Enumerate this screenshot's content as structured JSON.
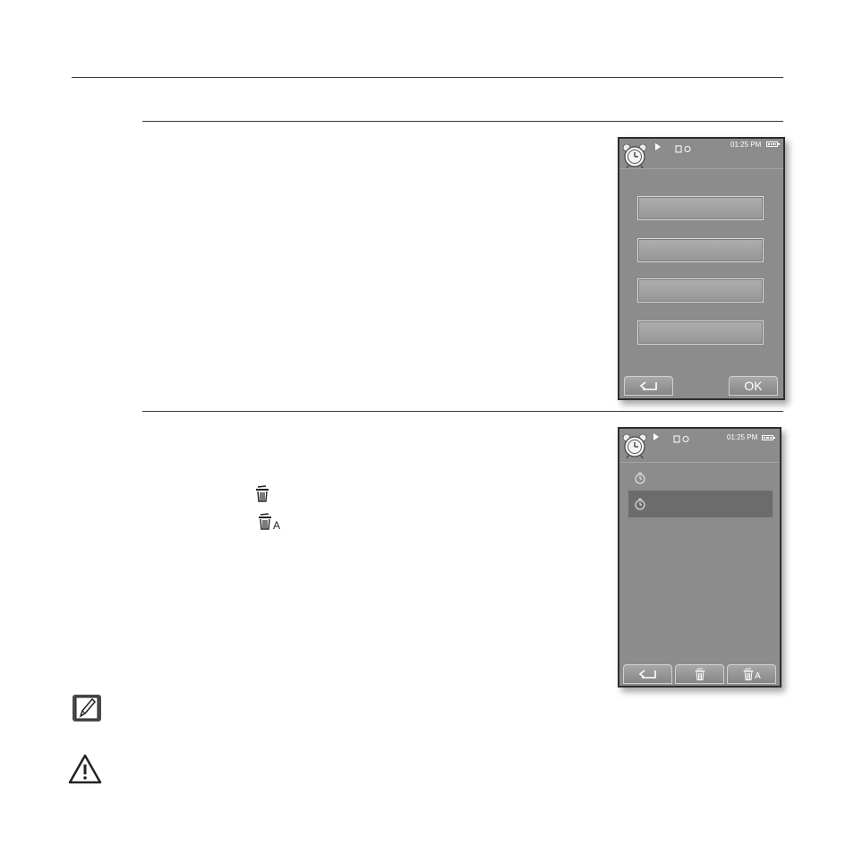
{
  "screen_top": {
    "status": {
      "time": "01:25 PM",
      "app_icon": "alarm-clock-icon",
      "play_icon": "play-icon",
      "battery_icon": "battery-icon"
    },
    "softkeys": {
      "back_icon": "back-arrow-icon",
      "ok_label": "OK"
    }
  },
  "screen_bottom": {
    "status": {
      "time": "01:25 PM",
      "app_icon": "alarm-clock-icon",
      "battery_icon": "battery-icon"
    },
    "list_item_icon": "timer-icon",
    "softkeys": {
      "back_icon": "back-arrow-icon",
      "delete_icon": "trash-icon",
      "delete_all_icon": "trash-all-icon",
      "delete_all_suffix": "A"
    }
  },
  "inline": {
    "delete_icon": "trash-icon",
    "delete_all_icon": "trash-all-icon",
    "delete_all_suffix": "A"
  },
  "notes": {
    "note_icon": "note-pencil-icon",
    "caution_icon": "warning-triangle-icon"
  }
}
